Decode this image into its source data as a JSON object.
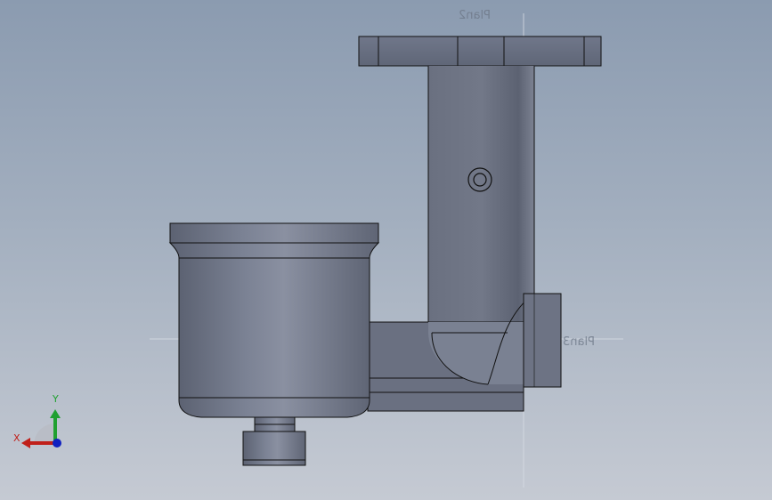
{
  "viewport": {
    "planes": [
      {
        "id": "plane2",
        "label": "Plan2"
      },
      {
        "id": "plane3",
        "label": "Plan3"
      }
    ]
  },
  "triad": {
    "x_label": "X",
    "y_label": "Y",
    "x_color": "#c0201a",
    "y_color": "#20a030",
    "z_color": "#1020c0"
  },
  "colors": {
    "background_top": "#8b9bb0",
    "background_bottom": "#c5cad3",
    "part_body": "#6e7485",
    "edge": "#111111"
  }
}
